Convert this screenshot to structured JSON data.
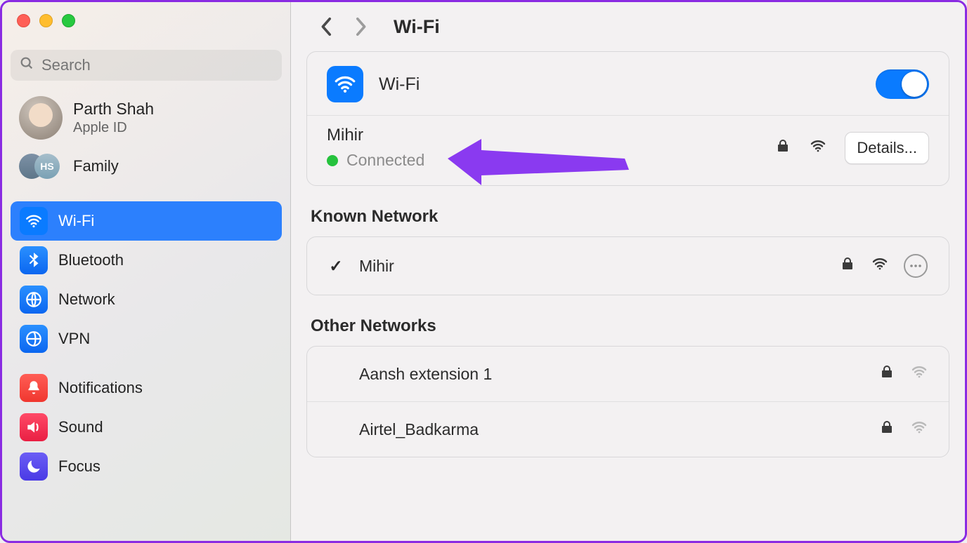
{
  "sidebar": {
    "search_placeholder": "Search",
    "account": {
      "name": "Parth Shah",
      "sub": "Apple ID"
    },
    "family": {
      "label": "Family",
      "badge": "HS"
    },
    "items": [
      {
        "label": "Wi-Fi"
      },
      {
        "label": "Bluetooth"
      },
      {
        "label": "Network"
      },
      {
        "label": "VPN"
      },
      {
        "label": "Notifications"
      },
      {
        "label": "Sound"
      },
      {
        "label": "Focus"
      }
    ]
  },
  "main": {
    "title": "Wi-Fi",
    "wifi": {
      "label": "Wi-Fi",
      "enabled": true,
      "current": {
        "name": "Mihir",
        "status": "Connected",
        "details_label": "Details..."
      }
    },
    "known": {
      "title": "Known Network",
      "items": [
        {
          "name": "Mihir",
          "connected": true
        }
      ]
    },
    "other": {
      "title": "Other Networks",
      "items": [
        {
          "name": "Aansh extension 1",
          "locked": true
        },
        {
          "name": "Airtel_Badkarma",
          "locked": true
        }
      ]
    }
  }
}
